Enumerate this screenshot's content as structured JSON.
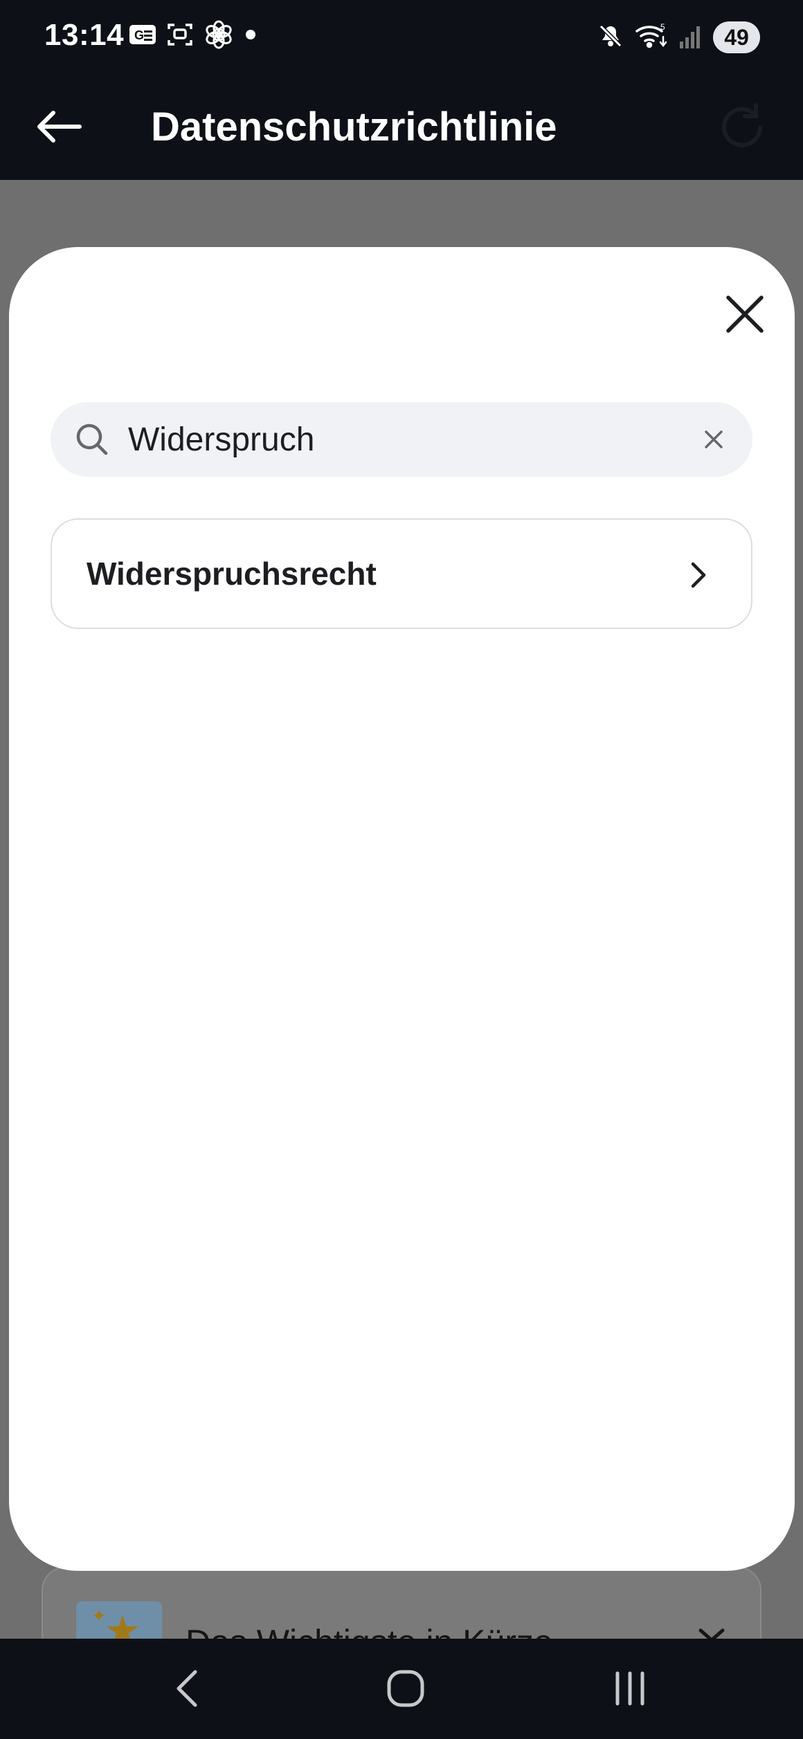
{
  "status_bar": {
    "time": "13:14",
    "battery_level": "49",
    "left_icons": [
      "sim-card-icon",
      "screen-capture-icon",
      "chatgpt-icon",
      "notification-dot-icon"
    ],
    "right_icons": [
      "mute-icon",
      "wifi-icon",
      "signal-icon",
      "battery-icon"
    ]
  },
  "header": {
    "title": "Datenschutzrichtlinie",
    "back_icon": "arrow-left-icon",
    "reload_icon": "reload-icon"
  },
  "search": {
    "value": "Widerspruch",
    "search_icon": "search-icon",
    "clear_icon": "close-icon"
  },
  "results": [
    {
      "label": "Widerspruchsrecht",
      "icon": "chevron-right-icon"
    }
  ],
  "background_page": {
    "card_title": "Das Wichtigste in Kürze"
  },
  "nav_bar": {
    "icons": [
      "nav-back-icon",
      "nav-home-icon",
      "nav-recents-icon"
    ]
  },
  "colors": {
    "header_bg": "#0d1117",
    "overlay": "#6f6f70",
    "sheet_bg": "#ffffff",
    "search_bg": "#f0f2f5",
    "text_primary": "#1c1e21"
  }
}
